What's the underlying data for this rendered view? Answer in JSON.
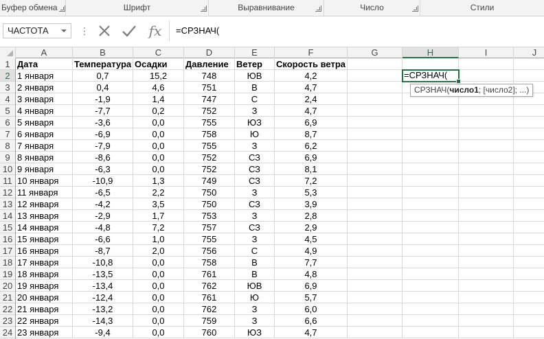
{
  "ribbon": {
    "groups": [
      "Буфер обмена",
      "Шрифт",
      "Выравнивание",
      "Число",
      "Стили"
    ]
  },
  "formula_bar": {
    "name_box": "ЧАСТОТА",
    "cancel_icon": "cancel-icon",
    "enter_icon": "check-icon",
    "fx_label": "fx",
    "formula": "=СРЗНАЧ("
  },
  "columns": [
    "A",
    "B",
    "C",
    "D",
    "E",
    "F",
    "G",
    "H",
    "I",
    "J"
  ],
  "selected_column": "H",
  "headers": {
    "date": "Дата",
    "temp": "Температура",
    "precip": "Осадки",
    "pressure": "Давление",
    "wind": "Ветер",
    "speed": "Скорость ветра"
  },
  "rows": [
    {
      "n": "1"
    },
    {
      "n": "2",
      "date": "1 января",
      "temp": "0,7",
      "precip": "15,2",
      "pressure": "748",
      "wind": "ЮВ",
      "speed": "4,2"
    },
    {
      "n": "3",
      "date": "2 января",
      "temp": "0,4",
      "precip": "4,6",
      "pressure": "751",
      "wind": "В",
      "speed": "4,7"
    },
    {
      "n": "4",
      "date": "3 января",
      "temp": "-1,9",
      "precip": "1,4",
      "pressure": "747",
      "wind": "С",
      "speed": "2,4"
    },
    {
      "n": "5",
      "date": "4 января",
      "temp": "-7,7",
      "precip": "0,2",
      "pressure": "752",
      "wind": "З",
      "speed": "4,7"
    },
    {
      "n": "6",
      "date": "5 января",
      "temp": "-3,6",
      "precip": "0,0",
      "pressure": "755",
      "wind": "ЮЗ",
      "speed": "6,9"
    },
    {
      "n": "7",
      "date": "6 января",
      "temp": "-6,9",
      "precip": "0,0",
      "pressure": "758",
      "wind": "Ю",
      "speed": "8,7"
    },
    {
      "n": "8",
      "date": "7 января",
      "temp": "-7,9",
      "precip": "0,0",
      "pressure": "755",
      "wind": "З",
      "speed": "6,2"
    },
    {
      "n": "9",
      "date": "8 января",
      "temp": "-8,6",
      "precip": "0,0",
      "pressure": "752",
      "wind": "СЗ",
      "speed": "6,9"
    },
    {
      "n": "10",
      "date": "9 января",
      "temp": "-6,3",
      "precip": "0,0",
      "pressure": "752",
      "wind": "СЗ",
      "speed": "8,1"
    },
    {
      "n": "11",
      "date": "10 января",
      "temp": "-10,9",
      "precip": "1,3",
      "pressure": "749",
      "wind": "СЗ",
      "speed": "7,2"
    },
    {
      "n": "12",
      "date": "11 января",
      "temp": "-6,5",
      "precip": "2,2",
      "pressure": "750",
      "wind": "З",
      "speed": "5,3"
    },
    {
      "n": "13",
      "date": "12 января",
      "temp": "-4,2",
      "precip": "3,5",
      "pressure": "750",
      "wind": "СЗ",
      "speed": "3,9"
    },
    {
      "n": "14",
      "date": "13 января",
      "temp": "-2,9",
      "precip": "1,7",
      "pressure": "753",
      "wind": "З",
      "speed": "2,8"
    },
    {
      "n": "15",
      "date": "14 января",
      "temp": "-4,8",
      "precip": "7,2",
      "pressure": "757",
      "wind": "СЗ",
      "speed": "2,9"
    },
    {
      "n": "16",
      "date": "15 января",
      "temp": "-6,6",
      "precip": "1,0",
      "pressure": "755",
      "wind": "З",
      "speed": "4,5"
    },
    {
      "n": "17",
      "date": "16 января",
      "temp": "-8,7",
      "precip": "2,0",
      "pressure": "756",
      "wind": "С",
      "speed": "4,9"
    },
    {
      "n": "18",
      "date": "17 января",
      "temp": "-10,8",
      "precip": "0,0",
      "pressure": "758",
      "wind": "В",
      "speed": "7,7"
    },
    {
      "n": "19",
      "date": "18 января",
      "temp": "-13,5",
      "precip": "0,0",
      "pressure": "761",
      "wind": "В",
      "speed": "4,8"
    },
    {
      "n": "20",
      "date": "19 января",
      "temp": "-13,4",
      "precip": "0,0",
      "pressure": "762",
      "wind": "ЮВ",
      "speed": "6,9"
    },
    {
      "n": "21",
      "date": "20 января",
      "temp": "-12,4",
      "precip": "0,0",
      "pressure": "761",
      "wind": "Ю",
      "speed": "5,7"
    },
    {
      "n": "22",
      "date": "21 января",
      "temp": "-13,2",
      "precip": "0,0",
      "pressure": "762",
      "wind": "З",
      "speed": "6,0"
    },
    {
      "n": "23",
      "date": "22 января",
      "temp": "-14,3",
      "precip": "0,0",
      "pressure": "759",
      "wind": "З",
      "speed": "6,6"
    },
    {
      "n": "24",
      "date": "23 января",
      "temp": "-9,4",
      "precip": "0,0",
      "pressure": "760",
      "wind": "ЮЗ",
      "speed": "4,7"
    }
  ],
  "active_cell": {
    "ref": "H2",
    "content": "=СРЗНАЧ("
  },
  "tooltip": {
    "fn": "СРЗНАЧ(",
    "arg1": "число1",
    "rest": "; [число2]; ...)"
  },
  "colors": {
    "accent": "#217346",
    "header_bg": "#f3f3f3",
    "gridline": "#d9d9d9"
  }
}
